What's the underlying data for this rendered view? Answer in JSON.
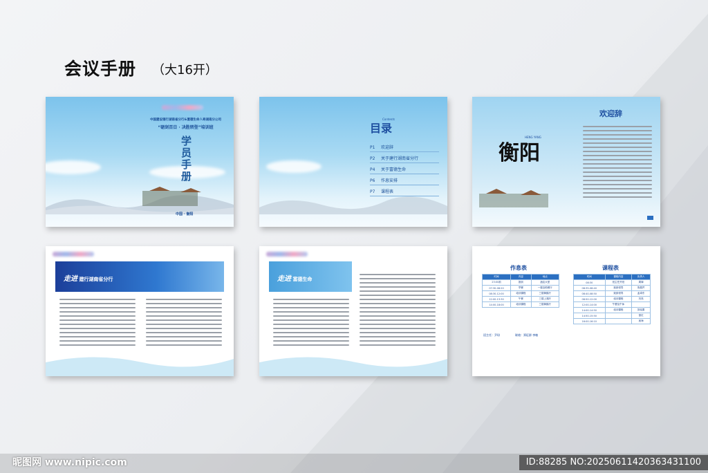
{
  "header": {
    "title": "会议手册",
    "subtitle": "（大16开）"
  },
  "cover": {
    "org_line": "中国建设银行湖南省分行&富德生命人寿湖南分公司",
    "program": "“砺剑百日 · 决胜转型”培训班",
    "handbook": "学员手册",
    "footer": "中国 · 衡阳"
  },
  "toc": {
    "title": "目录",
    "title_en": "Contents",
    "items": [
      {
        "page": "P1",
        "label": "欢迎辞"
      },
      {
        "page": "P2",
        "label": "关于建行湖南省分行"
      },
      {
        "page": "P4",
        "label": "关于富德生命"
      },
      {
        "page": "P6",
        "label": "作息安排"
      },
      {
        "page": "P7",
        "label": "课程表"
      }
    ]
  },
  "welcome": {
    "title": "欢迎辞",
    "calligraphy": "衡阳",
    "calligraphy_en": "HENG YANG"
  },
  "spread2": {
    "banner_script": "走进",
    "banner_text": "建行湖南省分行"
  },
  "spread3": {
    "banner_script": "走进",
    "banner_text": "富德生命"
  },
  "schedule": {
    "title": "作息表",
    "headers": [
      "时间",
      "内容",
      "地点"
    ],
    "rows": [
      [
        "23:00前",
        "报到",
        "酒店大堂"
      ],
      [
        "07:30-08:20",
        "早餐",
        "一楼自助餐厅"
      ],
      [
        "08:30-12:00",
        "培训课程",
        "三楼黄鹤厅"
      ],
      [
        "12:00-13:30",
        "午餐",
        "三楼上湘厅"
      ],
      [
        "14:00-18:00",
        "培训课程",
        "三楼黄鹤厅"
      ]
    ],
    "footer_left": "班主任：尹玢",
    "footer_right": "联络：郑征群  李敏"
  },
  "courses": {
    "title": "课程表",
    "headers": [
      "时间",
      "课程内容",
      "负责人"
    ],
    "rows": [
      [
        "08:30",
        "班主任开班",
        "周婵"
      ],
      [
        "08:35-08:40",
        "致辞领导",
        "鲁展芹"
      ],
      [
        "08:40-08:50",
        "致辞领导",
        "孟卓东"
      ],
      [
        "08:50-12:00",
        "培训课程",
        "刘亮"
      ],
      [
        "12:00-14:00",
        "午餐及午休",
        ""
      ],
      [
        "14:00-14:50",
        "培训课程",
        "张晓果"
      ],
      [
        "14:50-15:50",
        "",
        "邹红"
      ],
      [
        "16:00-16:10",
        "",
        "吴海"
      ]
    ]
  },
  "watermark": {
    "left": "昵图网  www.nipic.com",
    "right": "ID:88285 NO:20250611420363431100"
  },
  "colors": {
    "brand_blue": "#2b6fc1",
    "sky": "#7cc3ec",
    "text_dark": "#111111"
  }
}
